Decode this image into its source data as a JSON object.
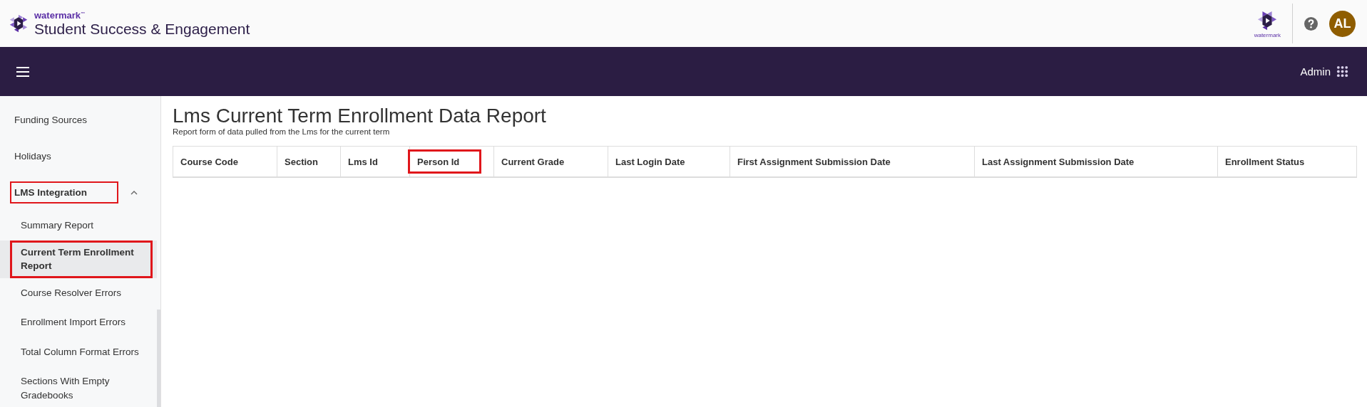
{
  "header": {
    "brand_small": "watermark",
    "brand_mark": "™",
    "product": "Student Success & Engagement",
    "partner_logo_text": "watermark",
    "avatar": "AL"
  },
  "navbar": {
    "role": "Admin"
  },
  "sidebar": {
    "items": [
      {
        "label": "Funding Sources",
        "selected": false,
        "highlighted": false
      },
      {
        "label": "Holidays",
        "selected": false,
        "highlighted": false
      },
      {
        "label": "LMS Integration",
        "selected": false,
        "highlighted": true,
        "expanded": true,
        "children": [
          {
            "label": "Summary Report",
            "selected": false,
            "highlighted": false
          },
          {
            "label": "Current Term Enrollment Report",
            "selected": true,
            "highlighted": true
          },
          {
            "label": "Course Resolver Errors",
            "selected": false,
            "highlighted": false
          },
          {
            "label": "Enrollment Import Errors",
            "selected": false,
            "highlighted": false
          },
          {
            "label": "Total Column Format Errors",
            "selected": false,
            "highlighted": false
          },
          {
            "label": "Sections With Empty Gradebooks",
            "selected": false,
            "highlighted": false
          }
        ]
      }
    ]
  },
  "page": {
    "title": "Lms Current Term Enrollment Data Report",
    "subtitle": "Report form of data pulled from the Lms for the current term"
  },
  "table": {
    "columns": [
      {
        "label": "Course Code",
        "highlighted": false
      },
      {
        "label": "Section",
        "highlighted": false
      },
      {
        "label": "Lms Id",
        "highlighted": false
      },
      {
        "label": "Person Id",
        "highlighted": true
      },
      {
        "label": "Current Grade",
        "highlighted": false
      },
      {
        "label": "Last Login Date",
        "highlighted": false
      },
      {
        "label": "First Assignment Submission Date",
        "highlighted": false
      },
      {
        "label": "Last Assignment Submission Date",
        "highlighted": false
      },
      {
        "label": "Enrollment Status",
        "highlighted": false
      }
    ]
  }
}
